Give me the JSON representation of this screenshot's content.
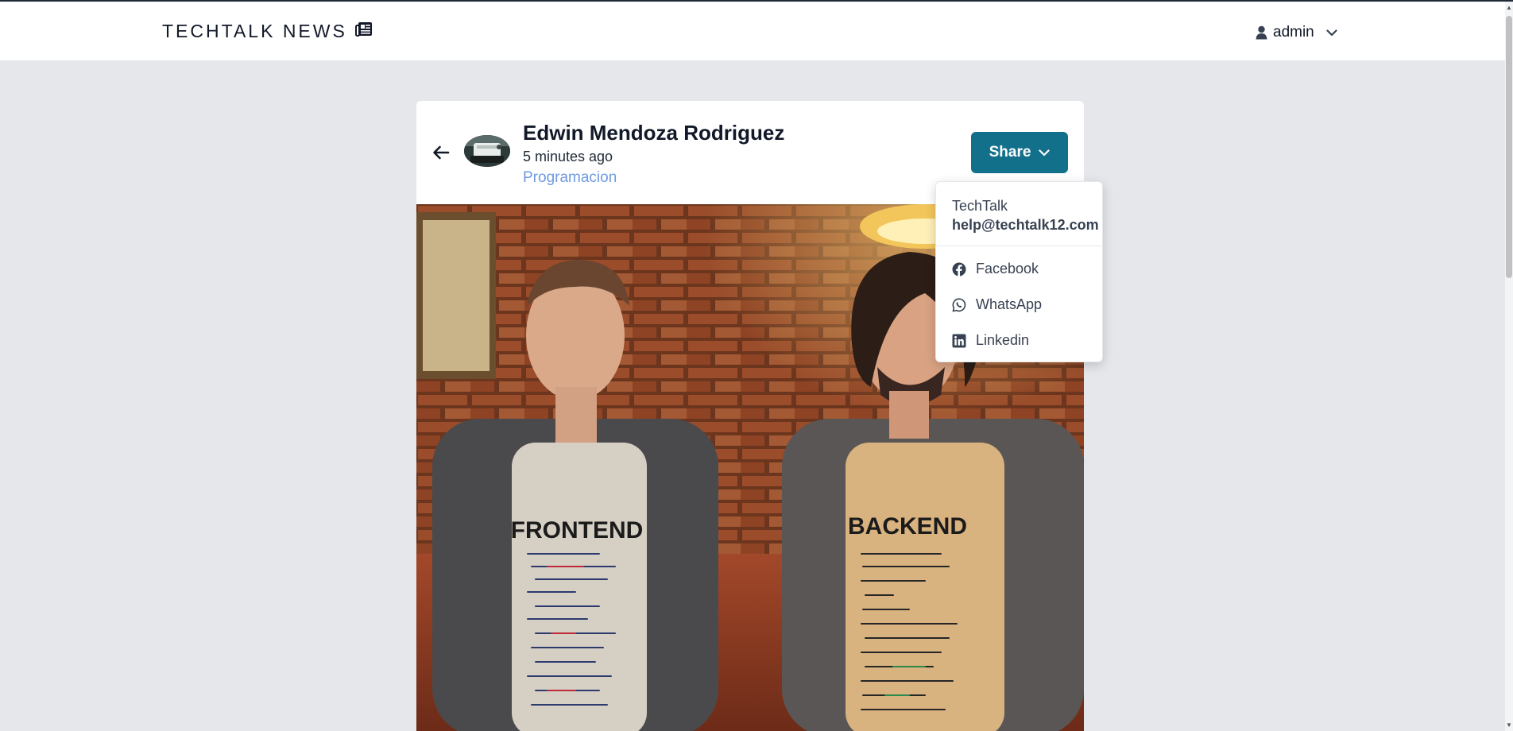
{
  "header": {
    "brand": "TECHTALK NEWS",
    "brand_icon": "newspaper-icon",
    "user_name": "admin",
    "user_icon": "user-icon",
    "user_chevron": "chevron-down-icon"
  },
  "post": {
    "author": "Edwin Mendoza Rodriguez",
    "time_ago": "5 minutes ago",
    "category": "Programacion",
    "share_label": "Share",
    "image_text_left": "FRONTEND",
    "image_text_right": "BACKEND"
  },
  "share_menu": {
    "org": "TechTalk",
    "email": "help@techtalk12.com",
    "items": [
      {
        "label": "Facebook",
        "icon": "facebook-icon"
      },
      {
        "label": "WhatsApp",
        "icon": "whatsapp-icon"
      },
      {
        "label": "Linkedin",
        "icon": "linkedin-icon"
      }
    ]
  },
  "colors": {
    "accent": "#13708a",
    "category": "#6f9ae0",
    "page_bg": "#e5e7eb"
  }
}
